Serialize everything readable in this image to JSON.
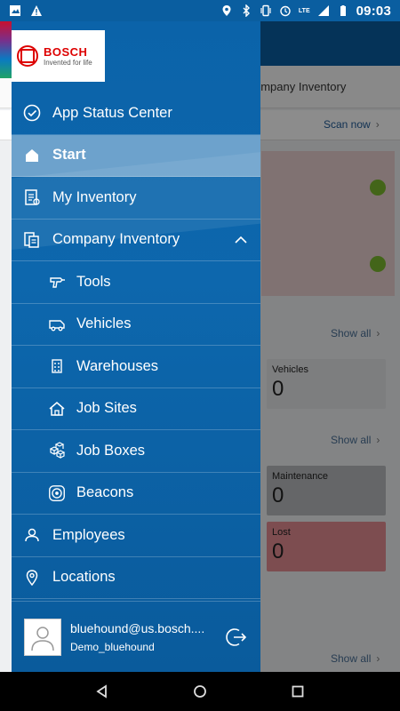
{
  "status_bar": {
    "time": "09:03",
    "lte": "LTE",
    "icons": [
      "image-icon",
      "warning-icon",
      "location-icon",
      "bluetooth-icon",
      "vibrate-icon",
      "alarm-icon",
      "signal-icon",
      "battery-icon"
    ]
  },
  "background_app": {
    "title": "ompany Inventory",
    "scan_now": "Scan now",
    "show_all_1": "Show all",
    "show_all_2": "Show all",
    "show_all_3": "Show all",
    "vehicles_label": "Vehicles",
    "vehicles_count": "0",
    "maintenance_label": "Maintenance",
    "maintenance_count": "0",
    "lost_label": "Lost",
    "lost_count": "0"
  },
  "drawer": {
    "brand": "BOSCH",
    "tagline": "Invented for life",
    "items": [
      {
        "label": "App Status Center",
        "icon": "check-circle-icon"
      },
      {
        "label": "Start",
        "icon": "home-icon"
      },
      {
        "label": "My Inventory",
        "icon": "inventory-icon"
      },
      {
        "label": "Company Inventory",
        "icon": "company-inventory-icon"
      },
      {
        "label": "Tools",
        "icon": "drill-icon"
      },
      {
        "label": "Vehicles",
        "icon": "van-icon"
      },
      {
        "label": "Warehouses",
        "icon": "building-icon"
      },
      {
        "label": "Job Sites",
        "icon": "house-icon"
      },
      {
        "label": "Job Boxes",
        "icon": "job-boxes-icon"
      },
      {
        "label": "Beacons",
        "icon": "beacon-icon"
      },
      {
        "label": "Employees",
        "icon": "person-icon"
      },
      {
        "label": "Locations",
        "icon": "location-pin-icon"
      }
    ],
    "profile": {
      "email": "bluehound@us.bosch....",
      "username": "Demo_bluehound"
    }
  },
  "colors": {
    "drawer_blue": "#0b63a9",
    "active_highlight": "#6fa8d6",
    "bosch_red": "#d00000",
    "ok_green": "#7ab82e"
  }
}
